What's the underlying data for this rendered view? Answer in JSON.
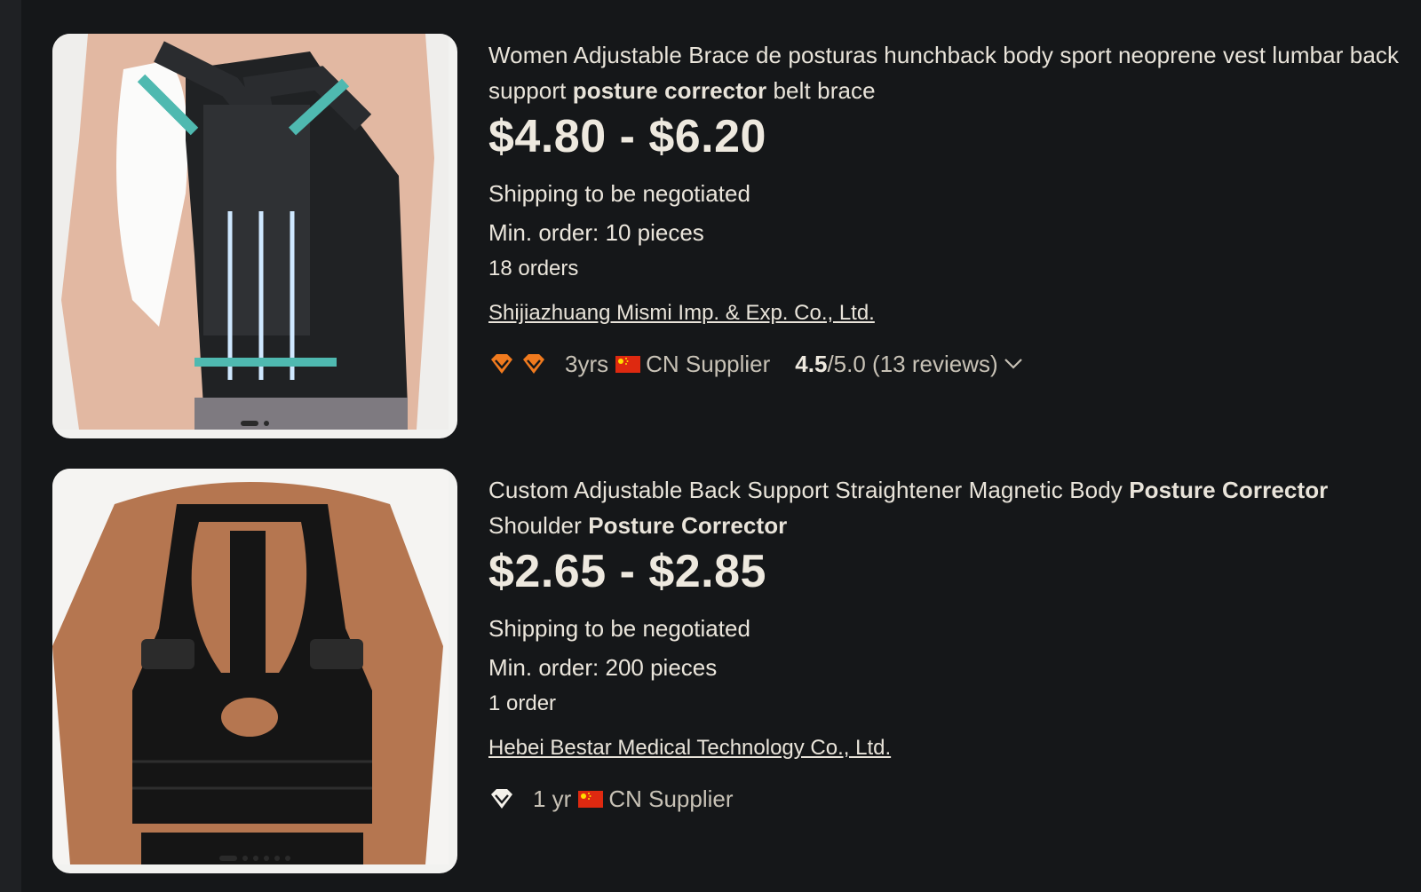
{
  "listings": [
    {
      "title_parts": [
        "Women Adjustable Brace de posturas hunchback body sport neoprene vest lumbar back support ",
        "posture corrector",
        " belt brace"
      ],
      "price": "$4.80 - $6.20",
      "shipping": "Shipping to be negotiated",
      "min_order": "Min. order: 10 pieces",
      "orders": "18 orders",
      "supplier_name": "Shijiazhuang Mismi Imp. & Exp. Co., Ltd.",
      "badge_icon": "orange-diamond-icon",
      "years": "3yrs",
      "supplier_type": "CN Supplier",
      "rating_score": "4.5",
      "rating_rest": "/5.0 (13 reviews)",
      "image_dots": 2
    },
    {
      "title_parts": [
        "Custom Adjustable Back Support Straightener Magnetic Body ",
        "Posture Corrector",
        " Shoulder ",
        "Posture Corrector"
      ],
      "price": "$2.65 - $2.85",
      "shipping": "Shipping to be negotiated",
      "min_order": "Min. order: 200 pieces",
      "orders": "1 order",
      "supplier_name": "Hebei Bestar Medical Technology Co., Ltd.",
      "badge_icon": "white-diamond-icon",
      "years": "1 yr",
      "supplier_type": "CN Supplier",
      "image_dots": 6
    }
  ],
  "colors": {
    "background": "#151719",
    "text": "#ebe6dc",
    "gem_orange": "#f07a1e",
    "flag_red": "#de2910",
    "flag_star": "#ffde00"
  }
}
